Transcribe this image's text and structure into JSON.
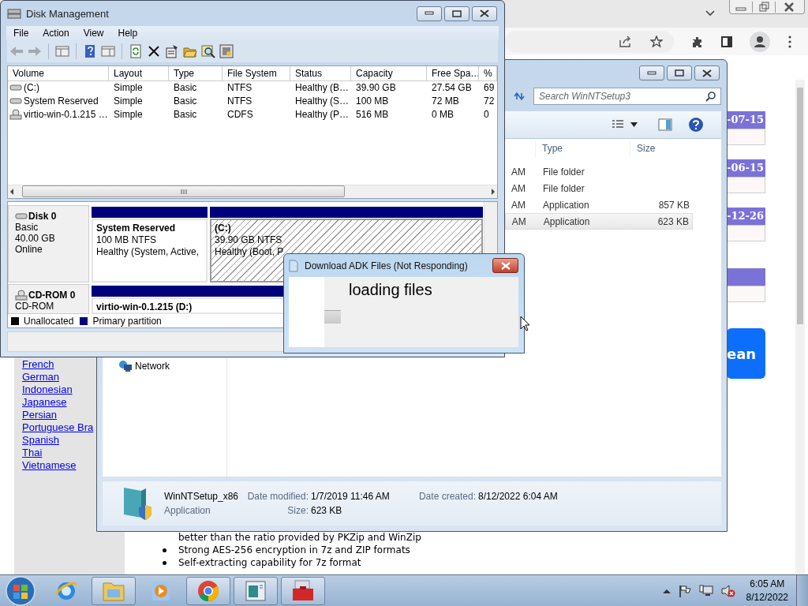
{
  "browser": {
    "links": [
      "French",
      "German",
      "Indonesian",
      "Japanese",
      "Persian",
      "Portuguese Bra",
      "Spanish",
      "Thai",
      "Vietnamese"
    ],
    "features": [
      {
        "text": "better than the ratio provided by PKZip and WinZip",
        "bullet": false
      },
      {
        "text": "Strong AES-256 encryption in 7z and ZIP formats",
        "bullet": true
      },
      {
        "text": "Self-extracting capability for 7z format",
        "bullet": true
      }
    ],
    "dates": [
      "-07-15",
      "-06-15",
      "-12-26"
    ],
    "button": "ean"
  },
  "explorer": {
    "search": {
      "placeholder": "Search WinNTSetup3"
    },
    "columns": [
      "Type",
      "Size"
    ],
    "rows": [
      {
        "modified": "AM",
        "type": "File folder",
        "selected": false
      },
      {
        "modified": "AM",
        "type": "File folder",
        "selected": false
      },
      {
        "modified": "AM",
        "type": "Application",
        "size": "857 KB",
        "selected": false
      },
      {
        "modified": "AM",
        "type": "Application",
        "size": "623 KB",
        "selected": true
      }
    ],
    "nav": [
      "Network"
    ],
    "details": {
      "name": "WinNTSetup_x86",
      "type": "Application",
      "modified_label": "Date modified:",
      "modified": "1/7/2019 11:46 AM",
      "created_label": "Date created:",
      "created": "8/12/2022 6:04 AM",
      "size_label": "Size:",
      "size": "623 KB"
    }
  },
  "disk_management": {
    "title": "Disk Management",
    "menu": [
      "File",
      "Action",
      "View",
      "Help"
    ],
    "toolbar": [
      [
        {
          "kind": "back",
          "disabled": true
        },
        {
          "kind": "forward",
          "disabled": true
        }
      ],
      [
        {
          "kind": "console",
          "disabled": false
        }
      ],
      [
        {
          "kind": "help",
          "disabled": false
        },
        {
          "kind": "panel",
          "disabled": false
        }
      ],
      [
        {
          "kind": "refresh",
          "disabled": false
        },
        {
          "kind": "delete",
          "disabled": false
        },
        {
          "kind": "properties",
          "disabled": false
        },
        {
          "kind": "open",
          "disabled": false
        },
        {
          "kind": "search",
          "disabled": false
        },
        {
          "kind": "settings",
          "disabled": false
        }
      ]
    ],
    "columns": [
      "Volume",
      "Layout",
      "Type",
      "File System",
      "Status",
      "Capacity",
      "Free Spa…",
      "%"
    ],
    "volumes": [
      {
        "kind": "disk",
        "cells": [
          "(C:)",
          "Simple",
          "Basic",
          "NTFS",
          "Healthy (B…",
          "39.90 GB",
          "27.54 GB",
          "69"
        ]
      },
      {
        "kind": "disk",
        "cells": [
          "System Reserved",
          "Simple",
          "Basic",
          "NTFS",
          "Healthy (S…",
          "100 MB",
          "72 MB",
          "72"
        ]
      },
      {
        "kind": "cd",
        "cells": [
          "virtio-win-0.1.215 …",
          "Simple",
          "Basic",
          "CDFS",
          "Healthy (P…",
          "516 MB",
          "0 MB",
          "0"
        ]
      }
    ],
    "disks": [
      {
        "kind": "disk",
        "name": "Disk 0",
        "lines": [
          "Basic",
          "40.00 GB",
          "Online"
        ],
        "partitions": [
          {
            "name": "System Reserved",
            "size": "100 MB NTFS",
            "status": "Healthy (System, Active,",
            "selected": false
          },
          {
            "name": "(C:)",
            "size": "39.90 GB NTFS",
            "status": "Healthy (Boot, P",
            "selected": true
          }
        ]
      },
      {
        "kind": "cd",
        "name": "CD-ROM 0",
        "lines": [
          "CD-ROM"
        ],
        "partitions": [
          {
            "name": "virtio-win-0.1.215  (D:)",
            "selected": false
          }
        ]
      }
    ],
    "legend": [
      {
        "label": "Unallocated",
        "color": "#000000"
      },
      {
        "label": "Primary partition",
        "color": "#000080"
      }
    ]
  },
  "dialog": {
    "title": "Download ADK Files (Not Responding)",
    "message": "loading files"
  },
  "taskbar": {
    "items": [
      {
        "kind": "ie",
        "running": false
      },
      {
        "kind": "explorer",
        "running": true
      },
      {
        "kind": "media",
        "running": false
      },
      {
        "kind": "chrome",
        "running": true
      },
      {
        "kind": "app",
        "running": true
      },
      {
        "kind": "toolbox",
        "running": true
      }
    ],
    "time": "6:05 AM",
    "date": "8/12/2022"
  }
}
